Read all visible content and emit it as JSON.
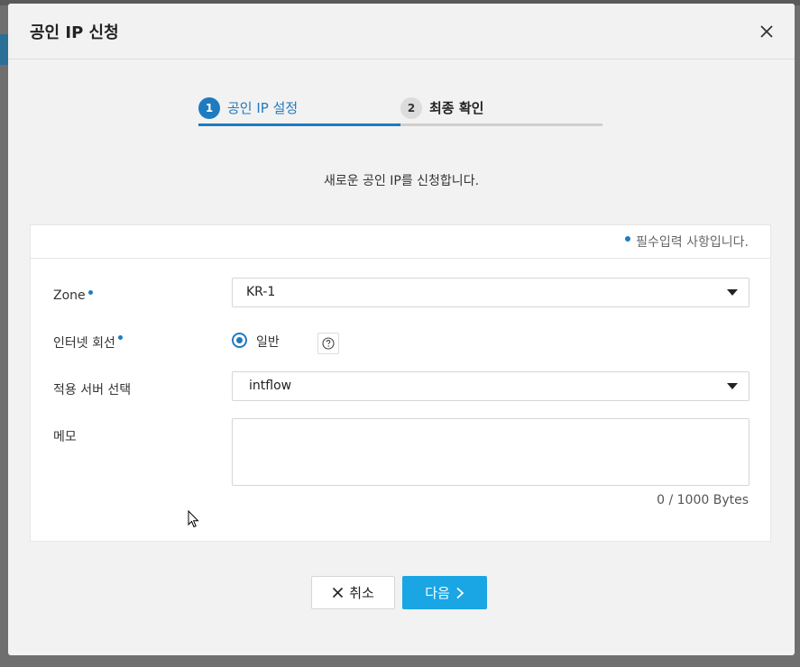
{
  "modal": {
    "title": "공인 IP 신청"
  },
  "steps": [
    {
      "number": "1",
      "label": "공인 IP 설정",
      "active": true
    },
    {
      "number": "2",
      "label": "최종 확인",
      "active": false
    }
  ],
  "description": "새로운 공인 IP를 신청합니다.",
  "form": {
    "required_note": "필수입력 사항입니다.",
    "zone": {
      "label": "Zone",
      "value": "KR-1"
    },
    "internet_line": {
      "label": "인터넷 회선",
      "option": "일반"
    },
    "server_select": {
      "label": "적용 서버 선택",
      "value": "intflow"
    },
    "memo": {
      "label": "메모",
      "value": "",
      "byte_count": "0 / 1000 Bytes"
    }
  },
  "buttons": {
    "cancel": "취소",
    "next": "다음"
  },
  "colors": {
    "accent": "#1f7bbf",
    "primary_button": "#1aa6e4"
  }
}
